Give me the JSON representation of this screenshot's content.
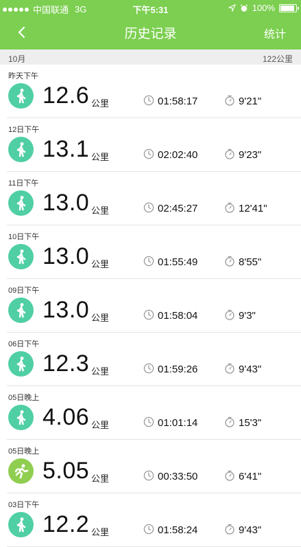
{
  "status_bar": {
    "carrier": "中国联通",
    "network": "3G",
    "time": "下午5:31",
    "battery_text": "100%",
    "battery_level": 1.0
  },
  "nav": {
    "title": "历史记录",
    "right_label": "统计",
    "back_icon": "chevron-left-icon"
  },
  "month": {
    "label": "10月",
    "total": "122公里"
  },
  "records": [
    {
      "when": "昨天下午",
      "distance": "12.6",
      "unit": "公里",
      "duration": "01:58:17",
      "pace": "9'21\"",
      "activity": "walk"
    },
    {
      "when": "12日下午",
      "distance": "13.1",
      "unit": "公里",
      "duration": "02:02:40",
      "pace": "9'23\"",
      "activity": "walk"
    },
    {
      "when": "11日下午",
      "distance": "13.0",
      "unit": "公里",
      "duration": "02:45:27",
      "pace": "12'41\"",
      "activity": "walk"
    },
    {
      "when": "10日下午",
      "distance": "13.0",
      "unit": "公里",
      "duration": "01:55:49",
      "pace": "8'55\"",
      "activity": "walk"
    },
    {
      "when": "09日下午",
      "distance": "13.0",
      "unit": "公里",
      "duration": "01:58:04",
      "pace": "9'3\"",
      "activity": "walk"
    },
    {
      "when": "06日下午",
      "distance": "12.3",
      "unit": "公里",
      "duration": "01:59:26",
      "pace": "9'43\"",
      "activity": "walk"
    },
    {
      "when": "05日晚上",
      "distance": "4.06",
      "unit": "公里",
      "duration": "01:01:14",
      "pace": "15'3\"",
      "activity": "walk"
    },
    {
      "when": "05日晚上",
      "distance": "5.05",
      "unit": "公里",
      "duration": "00:33:50",
      "pace": "6'41\"",
      "activity": "run"
    },
    {
      "when": "03日下午",
      "distance": "12.2",
      "unit": "公里",
      "duration": "01:58:24",
      "pace": "9'43\"",
      "activity": "walk"
    }
  ],
  "colors": {
    "header": "#7ccf50",
    "walk_badge": "#4fcfa3",
    "run_badge": "#8fce50"
  }
}
